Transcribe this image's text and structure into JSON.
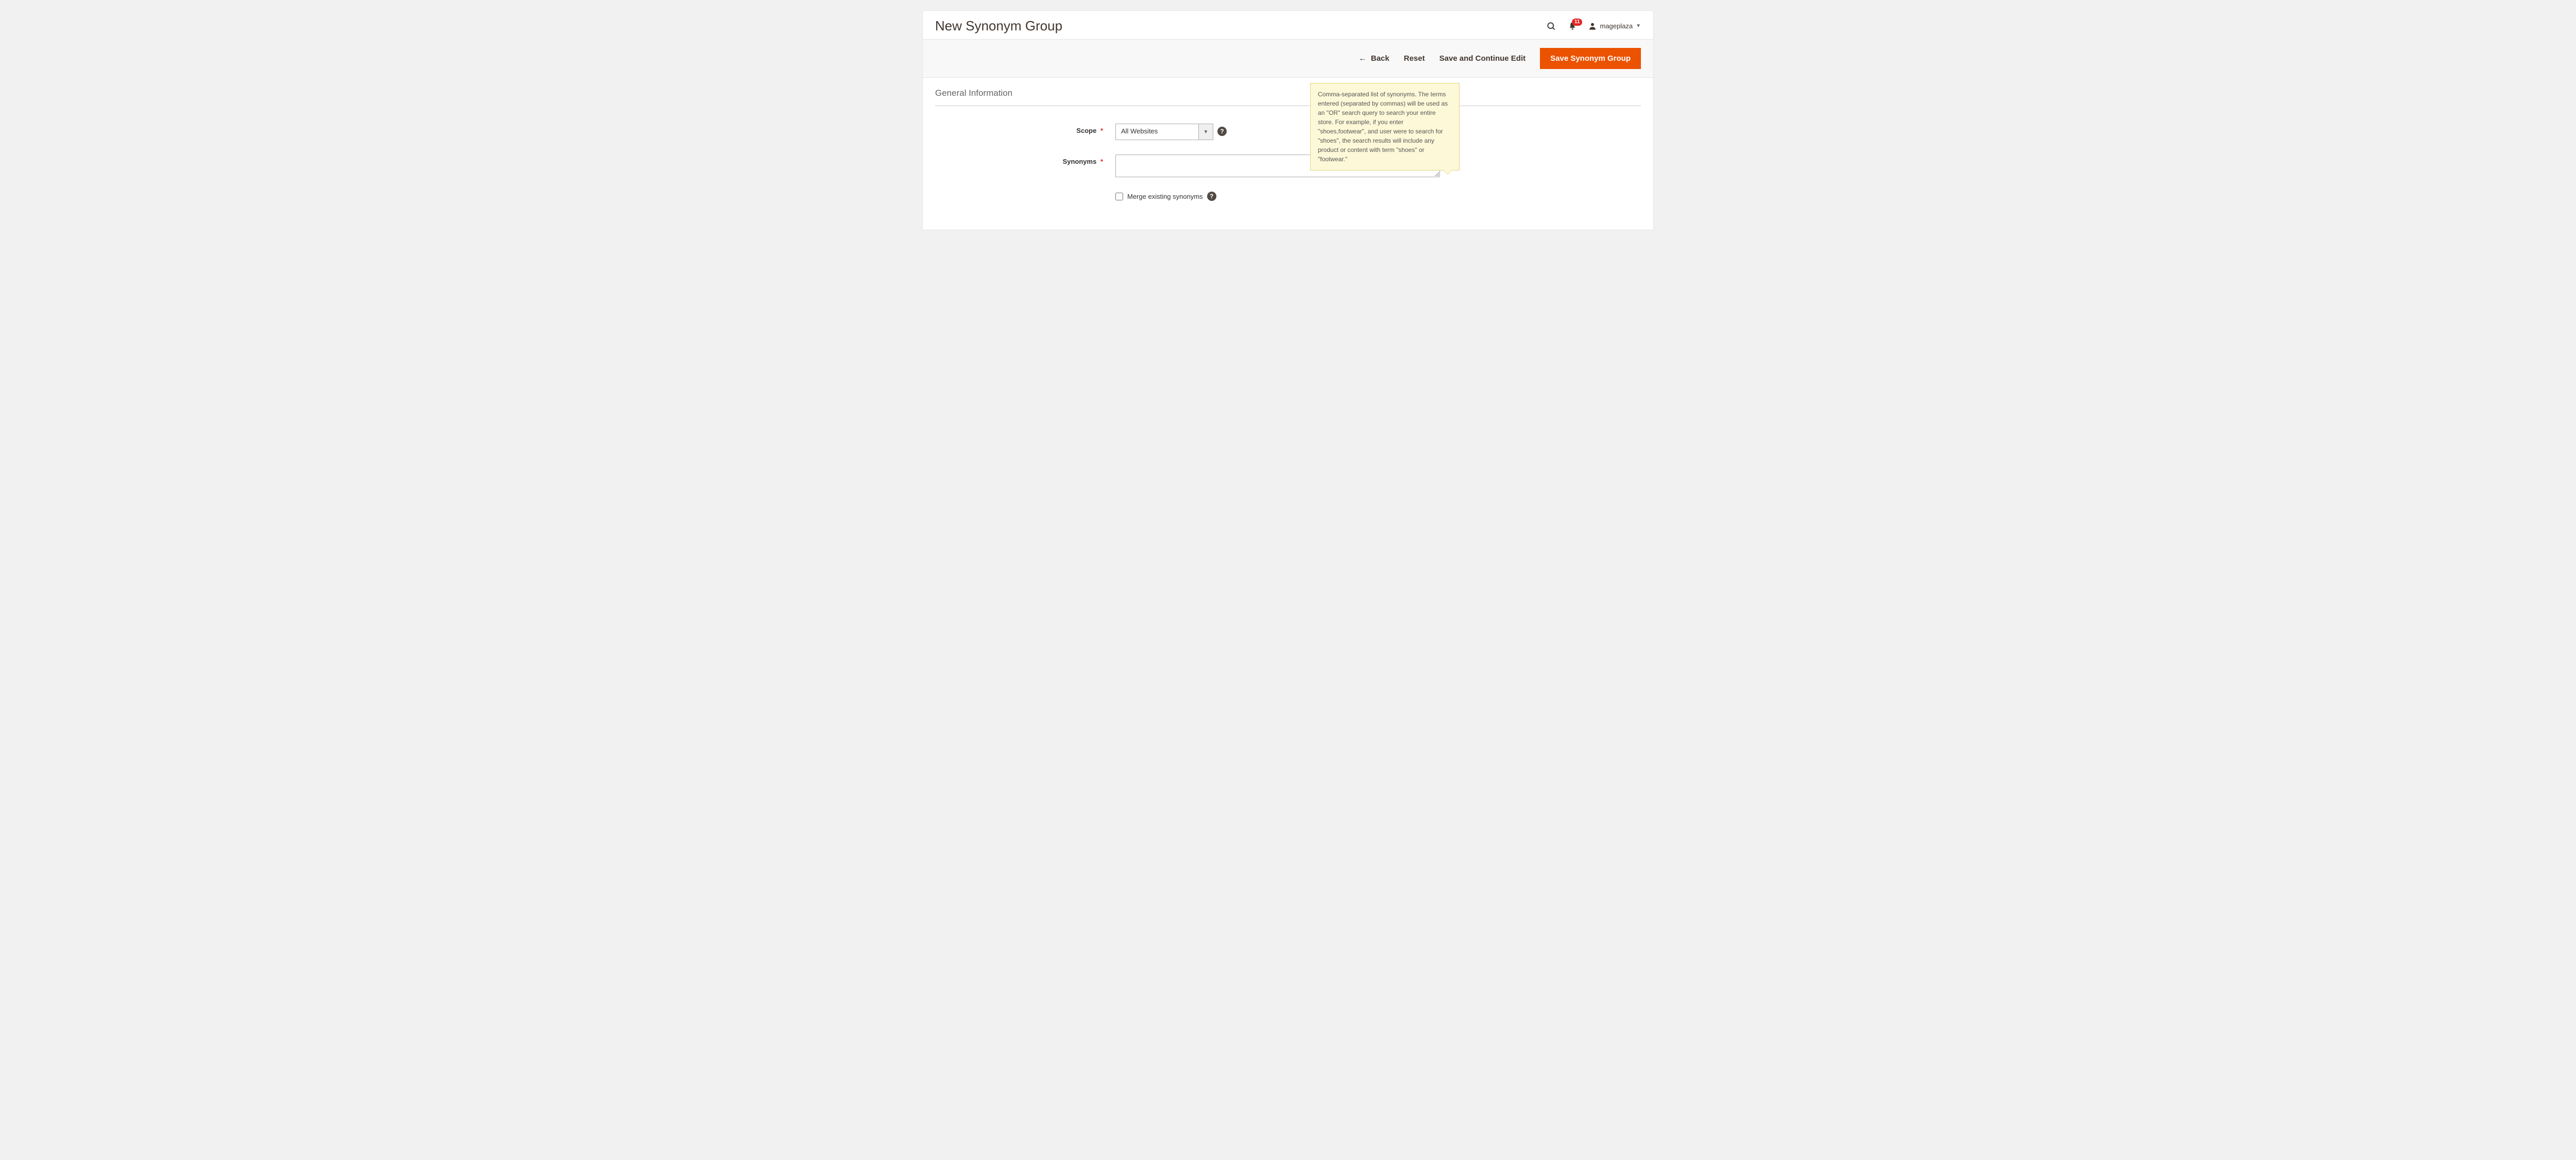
{
  "header": {
    "title": "New Synonym Group",
    "notifications_count": "11",
    "username": "mageplaza"
  },
  "toolbar": {
    "back_label": "Back",
    "reset_label": "Reset",
    "save_continue_label": "Save and Continue Edit",
    "save_label": "Save Synonym Group"
  },
  "section": {
    "title": "General Information"
  },
  "form": {
    "scope": {
      "label": "Scope",
      "value": "All Websites"
    },
    "synonyms": {
      "label": "Synonyms",
      "value": "",
      "tooltip": "Comma-separated list of synonyms. The terms entered (separated by commas) will be used as an \"OR\" search query to search your entire store. For example, if you enter \"shoes,footwear\", and user were to search for \"shoes\", the search results will include any product or content with term \"shoes\" or \"footwear.\""
    },
    "merge": {
      "label": "Merge existing synonyms"
    }
  }
}
